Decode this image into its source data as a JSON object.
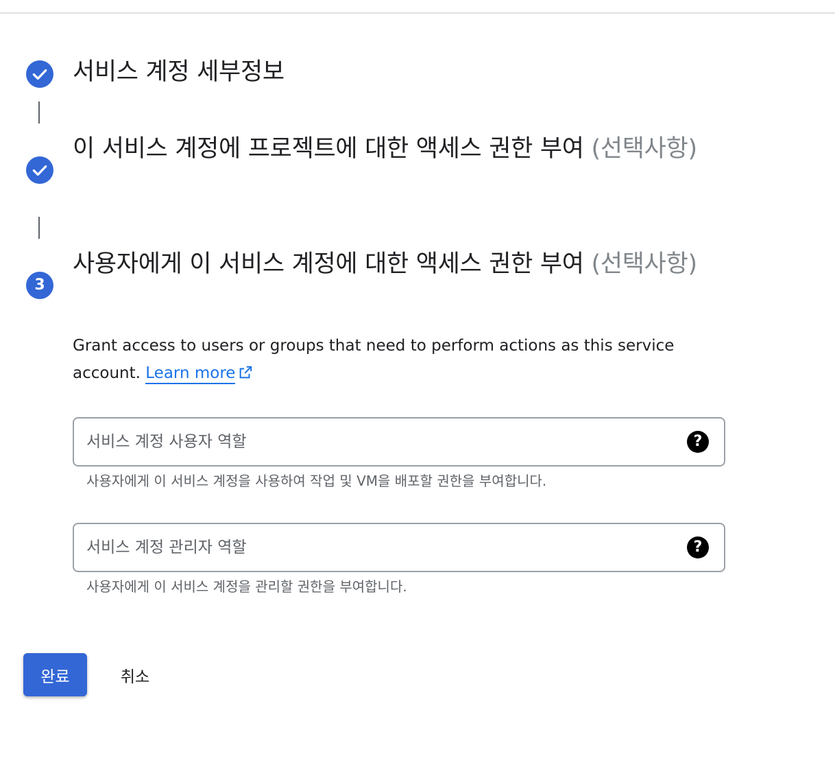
{
  "steps": [
    {
      "status": "completed",
      "title": "서비스 계정 세부정보",
      "optional": ""
    },
    {
      "status": "completed",
      "title": "이 서비스 계정에 프로젝트에 대한 액세스 권한 부여 ",
      "optional": "(선택사항)"
    },
    {
      "status": "active",
      "number": "3",
      "title": "사용자에게 이 서비스 계정에 대한 액세스 권한 부여 ",
      "optional": "(선택사항)"
    }
  ],
  "description": {
    "text": "Grant access to users or groups that need to perform actions as this service account. ",
    "link_label": "Learn more"
  },
  "fields": [
    {
      "placeholder": "서비스 계정 사용자 역할",
      "hint": "사용자에게 이 서비스 계정을 사용하여 작업 및 VM을 배포할 권한을 부여합니다."
    },
    {
      "placeholder": "서비스 계정 관리자 역할",
      "hint": "사용자에게 이 서비스 계정을 관리할 권한을 부여합니다."
    }
  ],
  "help_glyph": "?",
  "icons": {
    "completed": "check-circle-icon",
    "help": "help-circle-icon",
    "external": "open-in-new-icon"
  },
  "colors": {
    "accent": "#3367d6",
    "link": "#1a73e8",
    "optional_text": "#80868b"
  },
  "actions": {
    "done_label": "완료",
    "cancel_label": "취소"
  }
}
